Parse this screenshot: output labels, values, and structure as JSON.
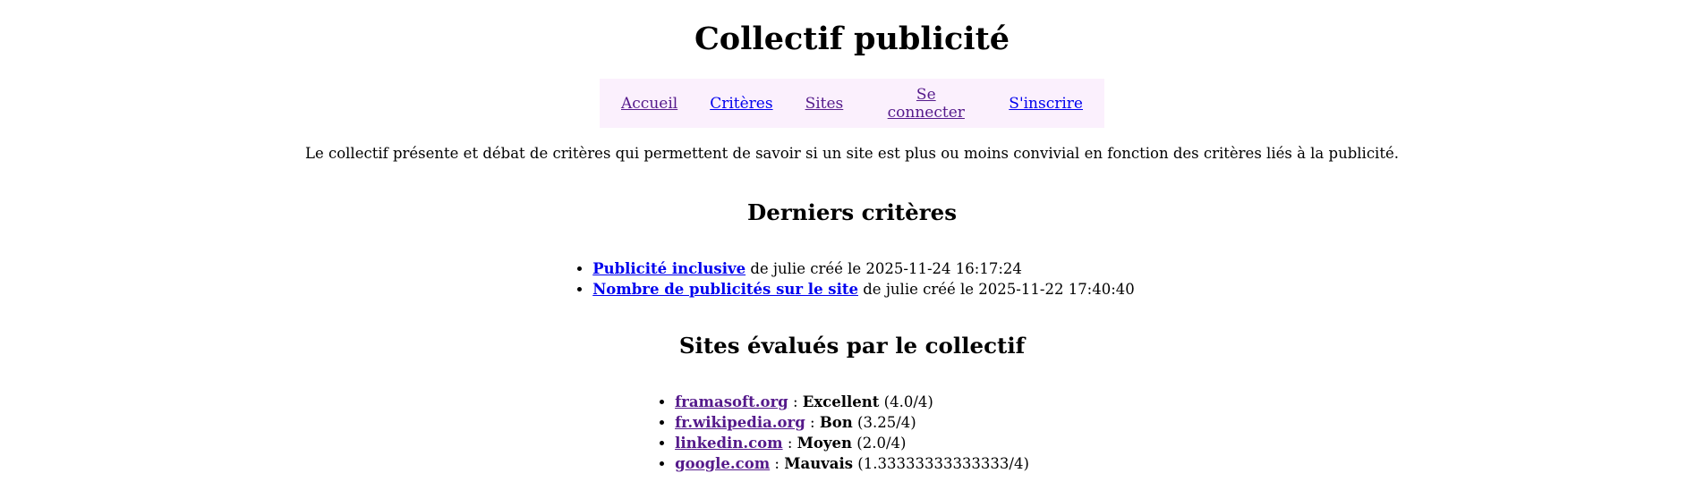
{
  "site_title": "Collectif publicité",
  "nav": {
    "items": [
      {
        "label": "Accueil"
      },
      {
        "label": "Critères"
      },
      {
        "label": "Sites"
      },
      {
        "label": "Se connecter"
      },
      {
        "label": "S'inscrire"
      }
    ]
  },
  "intro": "Le collectif présente et débat de critères qui permettent de savoir si un site est plus ou moins convivial en fonction des critères liés à la publicité.",
  "latest_criteria": {
    "heading": "Derniers critères",
    "items": [
      {
        "title": "Publicité inclusive",
        "meta": " de julie créé le 2025-11-24 16:17:24"
      },
      {
        "title": "Nombre de publicités sur le site",
        "meta": " de julie créé le 2025-11-22 17:40:40"
      }
    ]
  },
  "evaluated_sites": {
    "heading": "Sites évalués par le collectif",
    "items": [
      {
        "name": "framasoft.org",
        "rating": "Excellent",
        "score": " (4.0/4)"
      },
      {
        "name": "fr.wikipedia.org",
        "rating": "Bon",
        "score": " (3.25/4)"
      },
      {
        "name": "linkedin.com",
        "rating": "Moyen",
        "score": " (2.0/4)"
      },
      {
        "name": "google.com",
        "rating": "Mauvais",
        "score": " (1.33333333333333/4)"
      }
    ],
    "separator": " : "
  },
  "colors": {
    "nav_background": "#fbf0fd",
    "link_unvisited": "#0000ee",
    "link_visited": "#551a8b"
  }
}
